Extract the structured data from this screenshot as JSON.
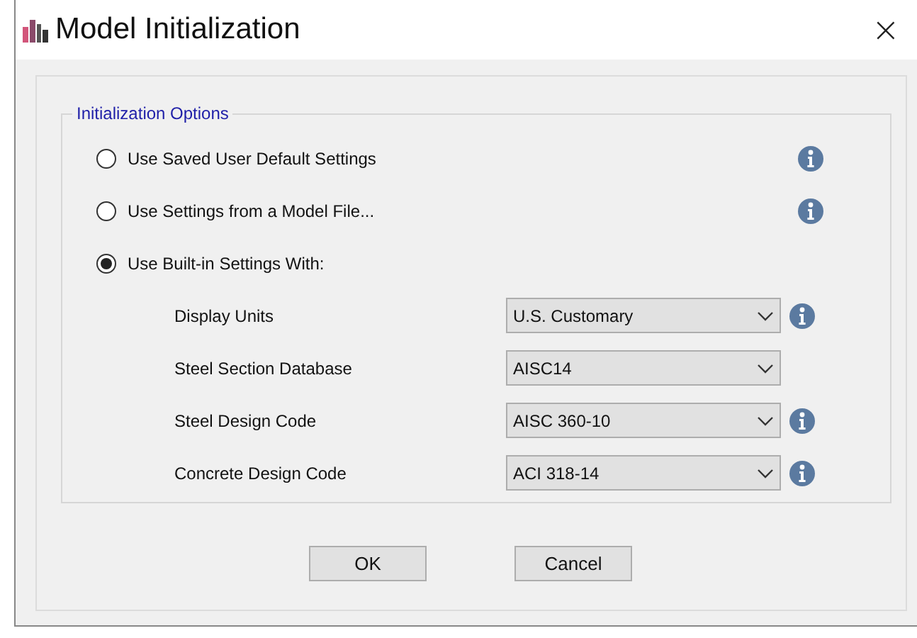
{
  "window": {
    "title": "Model Initialization",
    "close": "×"
  },
  "group": {
    "title": "Initialization Options",
    "options": [
      {
        "label": "Use Saved User Default Settings",
        "selected": false,
        "info": true
      },
      {
        "label": "Use Settings from a Model File...",
        "selected": false,
        "info": true
      },
      {
        "label": "Use Built-in Settings With:",
        "selected": true,
        "info": false
      }
    ],
    "settings": [
      {
        "label": "Display Units",
        "value": "U.S. Customary",
        "info": true
      },
      {
        "label": "Steel Section Database",
        "value": "AISC14",
        "info": false
      },
      {
        "label": "Steel Design Code",
        "value": "AISC 360-10",
        "info": true
      },
      {
        "label": "Concrete Design Code",
        "value": "ACI 318-14",
        "info": true
      }
    ]
  },
  "buttons": [
    "OK",
    "Cancel"
  ]
}
